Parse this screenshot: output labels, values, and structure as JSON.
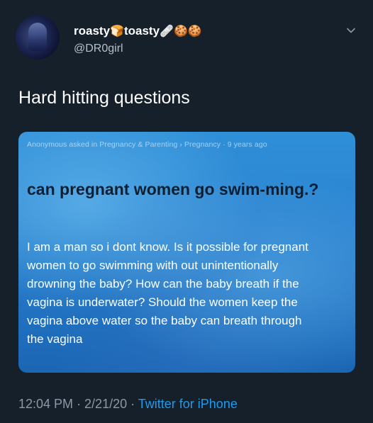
{
  "tweet": {
    "display_name_1": "roasty",
    "display_name_2": "toasty",
    "handle": "@DR0girl",
    "text": "Hard hitting questions",
    "timestamp": "12:04 PM · 2/21/20 ·",
    "source": "Twitter for iPhone",
    "emojis": [
      "bread-icon",
      "bandage-icon",
      "cookie-icon",
      "cookie-icon"
    ]
  },
  "card": {
    "meta": "Anonymous asked in Pregnancy & Parenting › Pregnancy · 9 years ago",
    "title": "can pregnant women go swim-ming.?",
    "body_lines": [
      "I am a man so i dont know. Is it possible for pregnant",
      "women to go swimming with out unintentionally",
      "drowning the baby? How can the baby breath if the",
      "vagina is underwater? Should the women keep the",
      "vagina above water so the baby can breath through",
      "the vagina"
    ]
  },
  "colors": {
    "background": "#15202b",
    "link": "#1d9bf0",
    "secondary_text": "#8b98a5",
    "card_blue": "#2a82cf",
    "title_text": "#0d1f33"
  }
}
